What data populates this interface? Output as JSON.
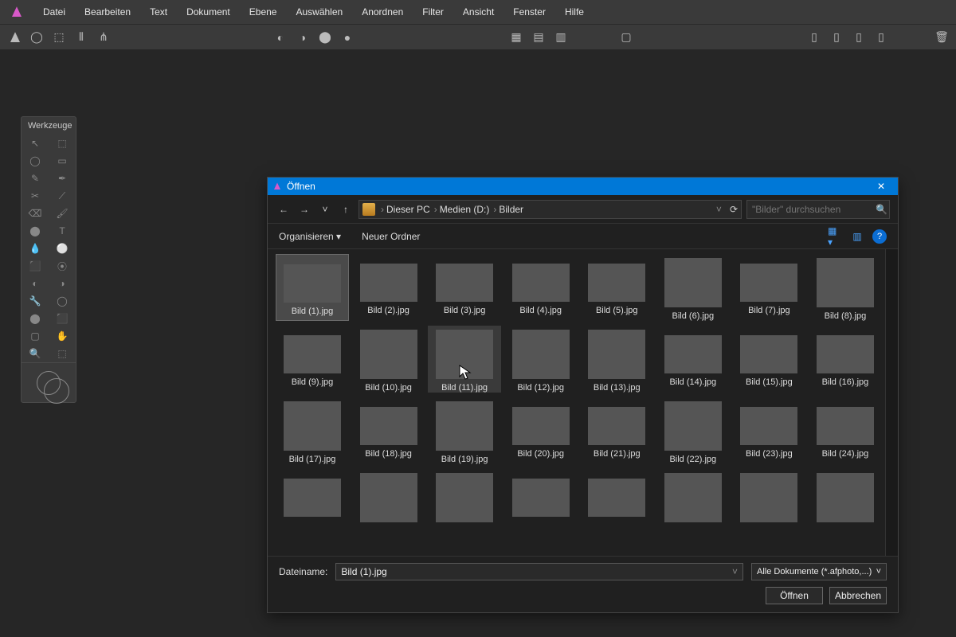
{
  "menu": {
    "items": [
      "Datei",
      "Bearbeiten",
      "Text",
      "Dokument",
      "Ebene",
      "Auswählen",
      "Anordnen",
      "Filter",
      "Ansicht",
      "Fenster",
      "Hilfe"
    ]
  },
  "panel": {
    "tools_title": "Werkzeuge"
  },
  "dialog": {
    "title": "Öffnen",
    "breadcrumb": [
      "Dieser PC",
      "Medien (D:)",
      "Bilder"
    ],
    "search_placeholder": "\"Bilder\" durchsuchen",
    "toolbar": {
      "organize": "Organisieren",
      "new_folder": "Neuer Ordner"
    },
    "filename_label": "Dateiname:",
    "filename_value": "Bild (1).jpg",
    "filter_label": "Alle Dokumente (*.afphoto,...)",
    "buttons": {
      "open": "Öffnen",
      "cancel": "Abbrechen"
    },
    "files": [
      {
        "name": "Bild (1).jpg",
        "cls": "c-ocean",
        "state": "selected"
      },
      {
        "name": "Bild (2).jpg",
        "cls": "c-arch"
      },
      {
        "name": "Bild (3).jpg",
        "cls": "c-dog"
      },
      {
        "name": "Bild (4).jpg",
        "cls": "c-sky"
      },
      {
        "name": "Bild (5).jpg",
        "cls": "c-clock"
      },
      {
        "name": "Bild (6).jpg",
        "cls": "c-city tall"
      },
      {
        "name": "Bild (7).jpg",
        "cls": "c-fall"
      },
      {
        "name": "Bild (8).jpg",
        "cls": "c-gym tall"
      },
      {
        "name": "Bild (9).jpg",
        "cls": "c-fox"
      },
      {
        "name": "Bild (10).jpg",
        "cls": "c-nyc tall"
      },
      {
        "name": "Bild (11).jpg",
        "cls": "c-mtn tall",
        "state": "hover"
      },
      {
        "name": "Bild (12).jpg",
        "cls": "c-silh tall"
      },
      {
        "name": "Bild (13).jpg",
        "cls": "c-tree tall"
      },
      {
        "name": "Bild (14).jpg",
        "cls": "c-lake"
      },
      {
        "name": "Bild (15).jpg",
        "cls": "c-parrot"
      },
      {
        "name": "Bild (16).jpg",
        "cls": "c-skate"
      },
      {
        "name": "Bild (17).jpg",
        "cls": "c-orange tall"
      },
      {
        "name": "Bild (18).jpg",
        "cls": "c-street"
      },
      {
        "name": "Bild (19).jpg",
        "cls": "c-neon tall"
      },
      {
        "name": "Bild (20).jpg",
        "cls": "c-eleph"
      },
      {
        "name": "Bild (21).jpg",
        "cls": "c-road"
      },
      {
        "name": "Bild (22).jpg",
        "cls": "c-bird tall"
      },
      {
        "name": "Bild (23).jpg",
        "cls": "c-couple"
      },
      {
        "name": "Bild (24).jpg",
        "cls": "c-couch"
      },
      {
        "name": "",
        "cls": "c-yellow"
      },
      {
        "name": "",
        "cls": "c-abstract tall"
      },
      {
        "name": "",
        "cls": "c-horizon tall"
      },
      {
        "name": "",
        "cls": "c-desert"
      },
      {
        "name": "",
        "cls": "c-dark"
      },
      {
        "name": "",
        "cls": "c-dress tall"
      },
      {
        "name": "",
        "cls": "c-port tall"
      },
      {
        "name": "",
        "cls": "c-sun tall"
      }
    ]
  }
}
